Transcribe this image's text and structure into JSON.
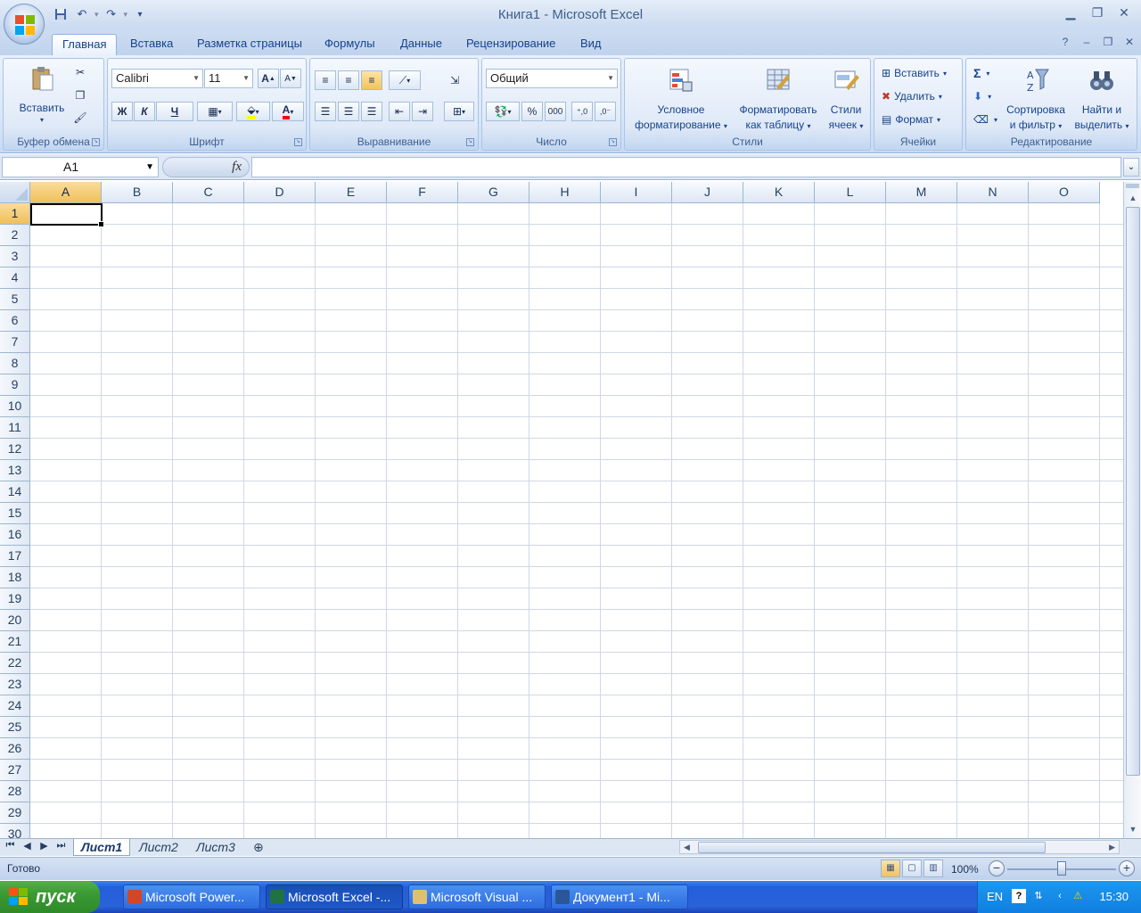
{
  "window": {
    "title": "Книга1 - Microsoft Excel"
  },
  "colors": {
    "ribbon": "#dbe7f7",
    "accent": "#f2c35c",
    "taskbar": "#245edb",
    "start": "#3a9a33"
  },
  "tabs": [
    {
      "label": "Главная",
      "active": true
    },
    {
      "label": "Вставка"
    },
    {
      "label": "Разметка страницы"
    },
    {
      "label": "Формулы"
    },
    {
      "label": "Данные"
    },
    {
      "label": "Рецензирование"
    },
    {
      "label": "Вид"
    }
  ],
  "ribbon": {
    "clipboard": {
      "label": "Буфер обмена",
      "paste": "Вставить"
    },
    "font": {
      "label": "Шрифт",
      "name": "Calibri",
      "size": "11",
      "bold": "Ж",
      "italic": "К",
      "underline": "Ч",
      "font_color_letter": "А",
      "grow": "A",
      "shrink": "A"
    },
    "alignment": {
      "label": "Выравнивание"
    },
    "number": {
      "label": "Число",
      "format": "Общий",
      "percent": "%",
      "thousands": "000"
    },
    "styles": {
      "label": "Стили",
      "conditional_1": "Условное",
      "conditional_2": "форматирование",
      "table_1": "Форматировать",
      "table_2": "как таблицу",
      "cell_1": "Стили",
      "cell_2": "ячеек"
    },
    "cells": {
      "label": "Ячейки",
      "insert": "Вставить",
      "delete": "Удалить",
      "format": "Формат"
    },
    "editing": {
      "label": "Редактирование",
      "sum": "Σ",
      "sort_1": "Сортировка",
      "sort_2": "и фильтр",
      "find_1": "Найти и",
      "find_2": "выделить"
    }
  },
  "formula_bar": {
    "name_box": "A1",
    "fx": "fx",
    "value": ""
  },
  "grid": {
    "columns": [
      "A",
      "B",
      "C",
      "D",
      "E",
      "F",
      "G",
      "H",
      "I",
      "J",
      "K",
      "L",
      "M",
      "N",
      "O"
    ],
    "rows": [
      "1",
      "2",
      "3",
      "4",
      "5",
      "6",
      "7",
      "8",
      "9",
      "10",
      "11",
      "12",
      "13",
      "14",
      "15",
      "16",
      "17",
      "18",
      "19",
      "20",
      "21",
      "22",
      "23",
      "24",
      "25",
      "26",
      "27",
      "28",
      "29",
      "30"
    ],
    "active_cell": "A1"
  },
  "sheets": [
    {
      "label": "Лист1",
      "active": true
    },
    {
      "label": "Лист2"
    },
    {
      "label": "Лист3"
    }
  ],
  "status": {
    "text": "Готово",
    "zoom": "100%"
  },
  "taskbar": {
    "start": "пуск",
    "items": [
      {
        "label": "Microsoft Power...",
        "icon": "powerpoint-icon"
      },
      {
        "label": "Microsoft Excel -...",
        "icon": "excel-icon",
        "active": true
      },
      {
        "label": "Microsoft Visual ...",
        "icon": "visual-basic-icon"
      },
      {
        "label": "Документ1 - Mi...",
        "icon": "word-icon"
      }
    ],
    "lang": "EN",
    "clock": "15:30"
  }
}
